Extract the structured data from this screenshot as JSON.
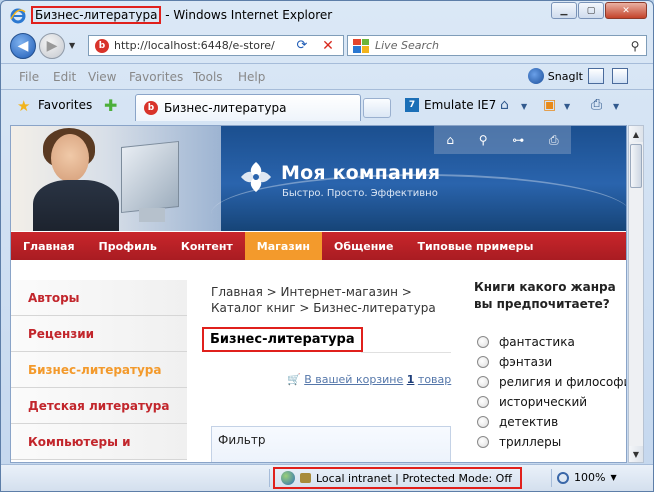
{
  "window": {
    "title_page": "Бизнес-литература",
    "title_suffix": " - Windows Internet Explorer"
  },
  "address": {
    "url": "http://localhost:6448/e-store/"
  },
  "search": {
    "placeholder": "Live Search"
  },
  "menu": {
    "items": [
      "File",
      "Edit",
      "View",
      "Favorites",
      "Tools",
      "Help"
    ],
    "snagit": "SnagIt"
  },
  "favbar": {
    "favorites_label": "Favorites",
    "tab_label": "Бизнес-литература",
    "emulate_label": "Emulate IE7"
  },
  "site": {
    "company": "Моя компания",
    "slogan": "Быстро. Просто. Эффективно",
    "nav": [
      "Главная",
      "Профиль",
      "Контент",
      "Магазин",
      "Общение",
      "Типовые примеры"
    ],
    "nav_active": "Магазин",
    "left_menu": [
      "Авторы",
      "Рецензии",
      "Бизнес-литература",
      "Детская литература",
      "Компьютеры и"
    ],
    "left_active": "Бизнес-литература",
    "breadcrumb": "Главная > Интернет-магазин > Каталог книг > Бизнес-литература",
    "page_title": "Бизнес-литература",
    "cart_prefix": "В вашей корзине",
    "cart_count": "1",
    "cart_suffix": "товар",
    "filter_label": "Фильтр",
    "poll_question": "Книги какого жанра вы предпочитаете?",
    "poll_options": [
      "фантастика",
      "фэнтази",
      "религия и философия",
      "исторический",
      "детектив",
      "триллеры"
    ]
  },
  "status": {
    "zone": "Local intranet | Protected Mode: Off",
    "zoom": "100%"
  },
  "colors": {
    "nav_red": "#c2262c",
    "nav_active": "#f39a2c",
    "highlight_red": "#e0201c"
  }
}
